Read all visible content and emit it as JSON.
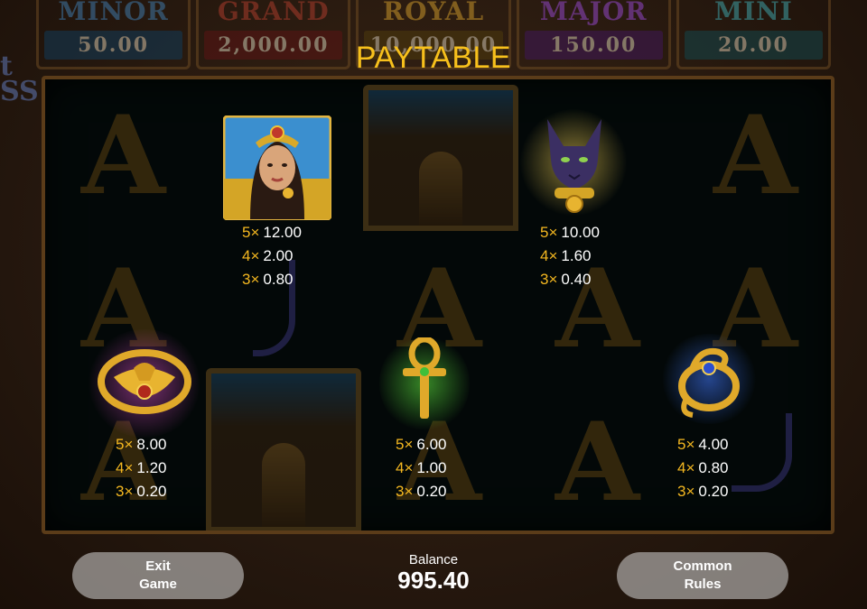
{
  "jackpots": [
    {
      "name": "MINOR",
      "value": "50.00"
    },
    {
      "name": "GRAND",
      "value": "2,000.00"
    },
    {
      "name": "ROYAL",
      "value": "10,000.00"
    },
    {
      "name": "MAJOR",
      "value": "150.00"
    },
    {
      "name": "MINI",
      "value": "20.00"
    }
  ],
  "title": "PAYTABLE",
  "paytable": [
    {
      "symbol": "cleopatra",
      "rows": [
        {
          "mult": "5×",
          "value": "12.00"
        },
        {
          "mult": "4×",
          "value": "2.00"
        },
        {
          "mult": "3×",
          "value": "0.80"
        }
      ]
    },
    {
      "symbol": "black-cat",
      "rows": [
        {
          "mult": "5×",
          "value": "10.00"
        },
        {
          "mult": "4×",
          "value": "1.60"
        },
        {
          "mult": "3×",
          "value": "0.40"
        }
      ]
    },
    {
      "symbol": "scarab-bracelet",
      "rows": [
        {
          "mult": "5×",
          "value": "8.00"
        },
        {
          "mult": "4×",
          "value": "1.20"
        },
        {
          "mult": "3×",
          "value": "0.20"
        }
      ]
    },
    {
      "symbol": "ankh",
      "rows": [
        {
          "mult": "5×",
          "value": "6.00"
        },
        {
          "mult": "4×",
          "value": "1.00"
        },
        {
          "mult": "3×",
          "value": "0.20"
        }
      ]
    },
    {
      "symbol": "snake-ring",
      "rows": [
        {
          "mult": "5×",
          "value": "4.00"
        },
        {
          "mult": "4×",
          "value": "0.80"
        },
        {
          "mult": "3×",
          "value": "0.20"
        }
      ]
    }
  ],
  "footer": {
    "exit_line1": "Exit",
    "exit_line2": "Game",
    "balance_label": "Balance",
    "balance_value": "995.40",
    "rules_line1": "Common",
    "rules_line2": "Rules"
  },
  "colors": {
    "title": "#f7c01c",
    "multiplier": "#f5b820",
    "button_bg": "#d7d7d7"
  }
}
